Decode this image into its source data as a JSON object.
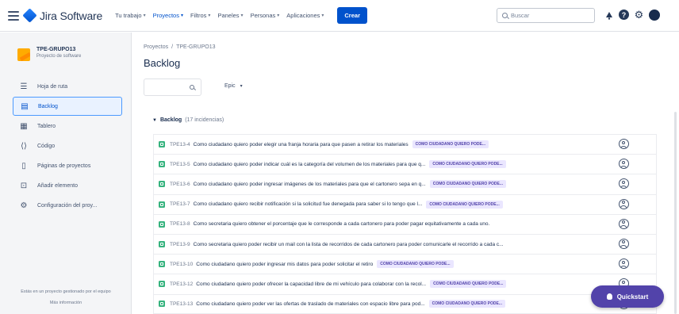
{
  "topnav": {
    "app_name": "Jira Software",
    "items": [
      {
        "label": "Tu trabajo"
      },
      {
        "label": "Proyectos"
      },
      {
        "label": "Filtros"
      },
      {
        "label": "Paneles"
      },
      {
        "label": "Personas"
      },
      {
        "label": "Aplicaciones"
      }
    ],
    "create_label": "Crear",
    "search_placeholder": "Buscar"
  },
  "sidebar": {
    "project_name": "TPE-GRUPO13",
    "project_type": "Proyecto de software",
    "items": [
      {
        "label": "Hoja de ruta",
        "icon": "roadmap-icon"
      },
      {
        "label": "Backlog",
        "icon": "backlog-icon"
      },
      {
        "label": "Tablero",
        "icon": "board-icon"
      },
      {
        "label": "Código",
        "icon": "code-icon"
      },
      {
        "label": "Páginas de proyectos",
        "icon": "pages-icon"
      },
      {
        "label": "Añadir elemento",
        "icon": "add-item-icon"
      },
      {
        "label": "Configuración del proy...",
        "icon": "settings-icon"
      }
    ],
    "footer_text": "Estás en un proyecto gestionado por el equipo",
    "footer_link": "Más información"
  },
  "main": {
    "breadcrumb": [
      "Proyectos",
      "TPE-GRUPO13"
    ],
    "title": "Backlog",
    "epic_filter": "Epic",
    "backlog_label": "Backlog",
    "backlog_count": "(17 incidencias)"
  },
  "issues": [
    {
      "key": "TPE13-4",
      "summary": "Como ciudadano quiero poder elegir una franja horaria para que pasen a retirar los materiales",
      "epic": "COMO CIUDADANO QUIERO PODE..."
    },
    {
      "key": "TPE13-5",
      "summary": "Como ciudadano quiero poder indicar cuál es la categoría del volumen de los materiales para que q...",
      "epic": "COMO CIUDADANO QUIERO PODE..."
    },
    {
      "key": "TPE13-6",
      "summary": "Como ciudadano quiero poder ingresar imágenes de los materiales para que el cartonero sepa en q...",
      "epic": "COMO CIUDADANO QUIERO PODE..."
    },
    {
      "key": "TPE13-7",
      "summary": "Como ciudadano quiero recibir notificación si la solicitud fue denegada para saber si lo tengo que l...",
      "epic": "COMO CIUDADANO QUIERO PODE..."
    },
    {
      "key": "TPE13-8",
      "summary": "Como secretaria quiero obtener el porcentaje que le corresponde a cada cartonero para poder pagar equitativamente a cada uno.",
      "epic": ""
    },
    {
      "key": "TPE13-9",
      "summary": "Como secretaria quiero poder recibir un mail con la lista de recorridos de cada cartonero para poder comunicarle el recorrido a cada c...",
      "epic": ""
    },
    {
      "key": "TPE13-10",
      "summary": "Como ciudadano quiero poder ingresar mis datos para poder solicitar el retiro",
      "epic": "COMO CIUDADANO QUIERO PODE..."
    },
    {
      "key": "TPE13-12",
      "summary": "Como ciudadano quiero poder ofrecer la capacidad libre de mi vehículo para colaborar con la recol...",
      "epic": "COMO CIUDADANO QUIERO PODE..."
    },
    {
      "key": "TPE13-13",
      "summary": "Como ciudadano quiero poder ver las ofertas de traslado de materiales con espacio libre para pod...",
      "epic": "COMO CIUDADANO QUIERO PODE..."
    }
  ],
  "quickstart_label": "Quickstart",
  "colors": {
    "accent": "#0052cc",
    "story": "#36b37e",
    "epic_bg": "#eae6ff",
    "epic_text": "#5243aa",
    "quickstart": "#5243aa"
  }
}
